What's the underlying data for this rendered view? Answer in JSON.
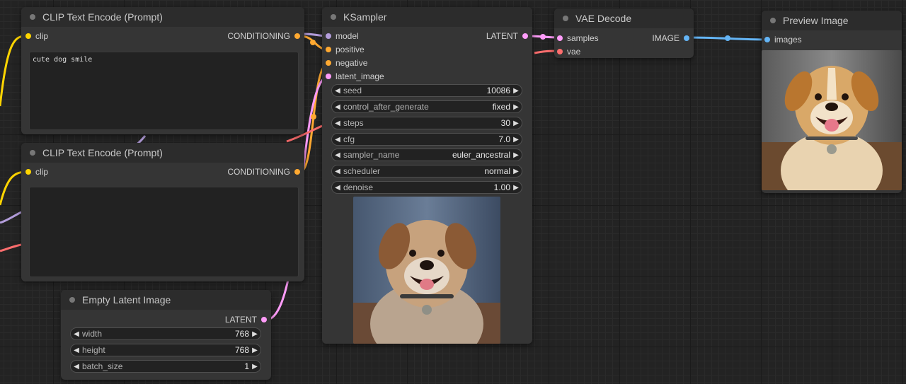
{
  "colors": {
    "conditioning": "#ffa931",
    "model": "#b39ddb",
    "latent": "#ff9cf9",
    "vae": "#ff6e6e",
    "image": "#64b5f6",
    "clip": "#ffd500"
  },
  "nodes": {
    "clip_positive": {
      "title": "CLIP Text Encode (Prompt)",
      "input_clip": "clip",
      "output_conditioning": "CONDITIONING",
      "prompt_text": "cute dog smile"
    },
    "clip_negative": {
      "title": "CLIP Text Encode (Prompt)",
      "input_clip": "clip",
      "output_conditioning": "CONDITIONING",
      "prompt_text": ""
    },
    "empty_latent": {
      "title": "Empty Latent Image",
      "output_latent": "LATENT",
      "widgets": [
        {
          "label": "width",
          "value": "768"
        },
        {
          "label": "height",
          "value": "768"
        },
        {
          "label": "batch_size",
          "value": "1"
        }
      ]
    },
    "ksampler": {
      "title": "KSampler",
      "inputs": [
        "model",
        "positive",
        "negative",
        "latent_image"
      ],
      "output_latent": "LATENT",
      "widgets": [
        {
          "label": "seed",
          "value": "10086"
        },
        {
          "label": "control_after_generate",
          "value": "fixed"
        },
        {
          "label": "steps",
          "value": "30"
        },
        {
          "label": "cfg",
          "value": "7.0"
        },
        {
          "label": "sampler_name",
          "value": "euler_ancestral"
        },
        {
          "label": "scheduler",
          "value": "normal"
        },
        {
          "label": "denoise",
          "value": "1.00"
        }
      ]
    },
    "vae_decode": {
      "title": "VAE Decode",
      "inputs": [
        "samples",
        "vae"
      ],
      "output_image": "IMAGE"
    },
    "preview_image": {
      "title": "Preview Image",
      "input_images": "images"
    }
  }
}
